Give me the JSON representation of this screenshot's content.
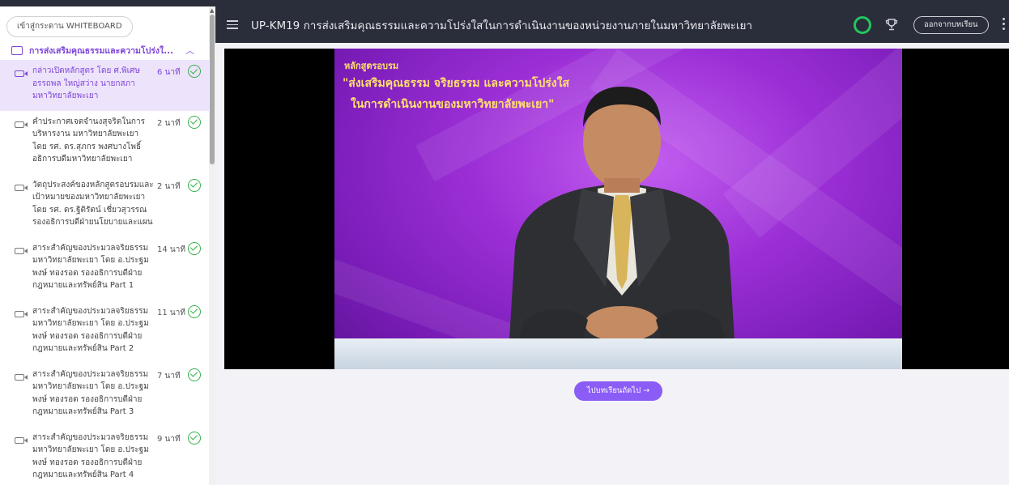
{
  "sidebar": {
    "whiteboard_label": "เข้าสู่กระดาน WHITEBOARD",
    "chapter_title": "การส่งเสริมคุณธรรมและความโปร่งใ...",
    "lessons": [
      {
        "title": "กล่าวเปิดหลักสูตร โดย ศ.พิเศษ อรรถพล ใหญ่สว่าง นายกสภามหาวิทยาลัยพะเยา",
        "duration": "6 นาที",
        "active": true
      },
      {
        "title": "คำประกาศเจตจำนงสุจริตในการบริหารงาน มหาวิทยาลัยพะเยา โดย รศ. ดร.สุภกร พงศบางโพธิ์ อธิการบดีมหาวิทยาลัยพะเยา",
        "duration": "2 นาที"
      },
      {
        "title": "วัตถุประสงค์ของหลักสูตรอบรมและเป้าหมายของมหาวิทยาลัยพะเยา โดย รศ. ดร.ฐิติรัตน์ เชี่ยวสุวรรณ รองอธิการบดีฝ่ายนโยบายและแผน",
        "duration": "2 นาที"
      },
      {
        "title": "สาระสำคัญของประมวลจริยธรรม มหาวิทยาลัยพะเยา โดย อ.ประฐมพงษ์ ทองรอด รองอธิการบดีฝ่ายกฎหมายและทรัพย์สิน Part 1",
        "duration": "14 นาที"
      },
      {
        "title": "สาระสำคัญของประมวลจริยธรรม มหาวิทยาลัยพะเยา โดย อ.ประฐมพงษ์ ทองรอด รองอธิการบดีฝ่ายกฎหมายและทรัพย์สิน Part 2",
        "duration": "11 นาที"
      },
      {
        "title": "สาระสำคัญของประมวลจริยธรรม มหาวิทยาลัยพะเยา โดย อ.ประฐมพงษ์ ทองรอด รองอธิการบดีฝ่ายกฎหมายและทรัพย์สิน Part 3",
        "duration": "7 นาที"
      },
      {
        "title": "สาระสำคัญของประมวลจริยธรรม มหาวิทยาลัยพะเยา โดย อ.ประฐมพงษ์ ทองรอด รองอธิการบดีฝ่ายกฎหมายและทรัพย์สิน Part 4",
        "duration": "9 นาที"
      }
    ]
  },
  "header": {
    "course_title": "UP-KM19 การส่งเสริมคุณธรรมและความโปร่งใสในการดำเนินงานของหน่วยงานภายในมหาวิทยาลัยพะเยา",
    "exit_label": "ออกจากบทเรียน"
  },
  "video": {
    "course_type": "หลักสูตรอบรม",
    "course_name_line1": "\"ส่งเสริมคุณธรรม จริยธรรม และความโปร่งใส",
    "course_name_line2": "ในการดำเนินงานของมหาวิทยาลัยพะเยา\""
  },
  "next_label": "ไปบทเรียนถัดไป →",
  "colors": {
    "accent": "#7e46d9",
    "header_bg": "#2a2d3a",
    "check": "#34b24a",
    "button": "#8b5cf6",
    "ring": "#22c55e"
  }
}
